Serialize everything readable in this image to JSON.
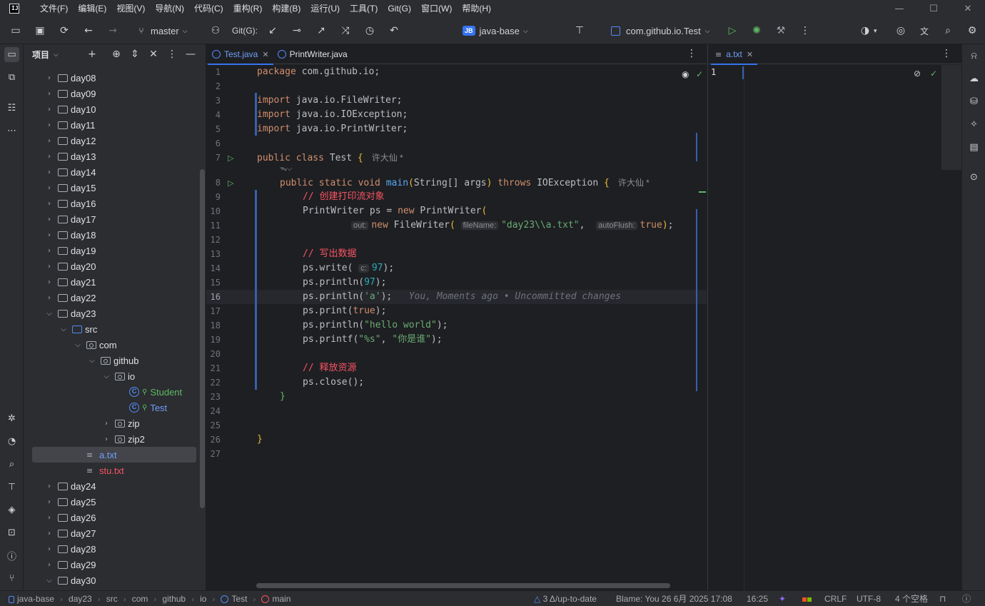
{
  "titlebar": {
    "menu": [
      "文件(F)",
      "编辑(E)",
      "视图(V)",
      "导航(N)",
      "代码(C)",
      "重构(R)",
      "构建(B)",
      "运行(U)",
      "工具(T)",
      "Git(G)",
      "窗口(W)",
      "帮助(H)"
    ],
    "minimize_glyph": "—",
    "maximize_glyph": "☐",
    "close_glyph": "✕"
  },
  "toolbar": {
    "branch": "master",
    "git_label": "Git(G):",
    "project_badge": "JB",
    "project_name": "java-base",
    "run_config": "com.github.io.Test"
  },
  "project_panel": {
    "title": "项目",
    "tree": [
      {
        "label": "day08",
        "type": "folder",
        "depth": 1,
        "expanded": false
      },
      {
        "label": "day09",
        "type": "folder",
        "depth": 1,
        "expanded": false
      },
      {
        "label": "day10",
        "type": "folder",
        "depth": 1,
        "expanded": false
      },
      {
        "label": "day11",
        "type": "folder",
        "depth": 1,
        "expanded": false
      },
      {
        "label": "day12",
        "type": "folder",
        "depth": 1,
        "expanded": false
      },
      {
        "label": "day13",
        "type": "folder",
        "depth": 1,
        "expanded": false
      },
      {
        "label": "day14",
        "type": "folder",
        "depth": 1,
        "expanded": false
      },
      {
        "label": "day15",
        "type": "folder",
        "depth": 1,
        "expanded": false
      },
      {
        "label": "day16",
        "type": "folder",
        "depth": 1,
        "expanded": false
      },
      {
        "label": "day17",
        "type": "folder",
        "depth": 1,
        "expanded": false
      },
      {
        "label": "day18",
        "type": "folder",
        "depth": 1,
        "expanded": false
      },
      {
        "label": "day19",
        "type": "folder",
        "depth": 1,
        "expanded": false
      },
      {
        "label": "day20",
        "type": "folder",
        "depth": 1,
        "expanded": false
      },
      {
        "label": "day21",
        "type": "folder",
        "depth": 1,
        "expanded": false
      },
      {
        "label": "day22",
        "type": "folder",
        "depth": 1,
        "expanded": false
      },
      {
        "label": "day23",
        "type": "folder",
        "depth": 1,
        "expanded": true
      },
      {
        "label": "src",
        "type": "src",
        "depth": 2,
        "expanded": true
      },
      {
        "label": "com",
        "type": "pkg",
        "depth": 3,
        "expanded": true
      },
      {
        "label": "github",
        "type": "pkg",
        "depth": 4,
        "expanded": true
      },
      {
        "label": "io",
        "type": "pkg",
        "depth": 5,
        "expanded": true
      },
      {
        "label": "Student",
        "type": "class",
        "depth": 6,
        "color": "green"
      },
      {
        "label": "Test",
        "type": "class",
        "depth": 6,
        "color": "blue"
      },
      {
        "label": "zip",
        "type": "pkg",
        "depth": 5,
        "expanded": false
      },
      {
        "label": "zip2",
        "type": "pkg",
        "depth": 5,
        "expanded": false
      },
      {
        "label": "a.txt",
        "type": "txt",
        "depth": 3,
        "color": "blue",
        "selected": true
      },
      {
        "label": "stu.txt",
        "type": "txt",
        "depth": 3,
        "color": "red"
      },
      {
        "label": "day24",
        "type": "folder",
        "depth": 1,
        "expanded": false
      },
      {
        "label": "day25",
        "type": "folder",
        "depth": 1,
        "expanded": false
      },
      {
        "label": "day26",
        "type": "folder",
        "depth": 1,
        "expanded": false
      },
      {
        "label": "day27",
        "type": "folder",
        "depth": 1,
        "expanded": false
      },
      {
        "label": "day28",
        "type": "folder",
        "depth": 1,
        "expanded": false
      },
      {
        "label": "day29",
        "type": "folder",
        "depth": 1,
        "expanded": false
      },
      {
        "label": "day30",
        "type": "folder",
        "depth": 1,
        "expanded": true
      }
    ]
  },
  "editor": {
    "tabs": [
      {
        "label": "Test.java",
        "active": true
      },
      {
        "label": "PrintWriter.java",
        "active": false
      }
    ],
    "current_line": 16,
    "author": "许大仙 *",
    "blame_inline": "You, Moments ago • Uncommitted changes",
    "line_numbers": [
      "1",
      "2",
      "3",
      "4",
      "5",
      "6",
      "7",
      "8",
      "9",
      "10",
      "11",
      "12",
      "13",
      "14",
      "15",
      "16",
      "17",
      "18",
      "19",
      "20",
      "21",
      "22",
      "23",
      "24",
      "25",
      "26",
      "27"
    ],
    "code": {
      "l1_pkg": "com.github.io;",
      "l3": "java.io.FileWriter;",
      "l4": "java.io.IOException;",
      "l5": "java.io.PrintWriter;",
      "l7_class": "Test",
      "l8_exc": "IOException",
      "l9_comment": "// 创建打印流对象",
      "l10": "PrintWriter ps = ",
      "l10_new": "new",
      "l10_tail": " PrintWriter",
      "hint_out": "out:",
      "hint_filename": "fileName:",
      "l11_str": "\"day23\\\\a.txt\"",
      "hint_autoflush": "autoFlush:",
      "l13_comment": "// 写出数据",
      "l14_call": "ps.write(",
      "hint_c": "c:",
      "l14_num": "97",
      "l15_call": "ps.println(",
      "l15_num": "97",
      "l16_call": "ps.println(",
      "l16_chr": "'a'",
      "l17_call": "ps.print(",
      "l18_call": "ps.println(",
      "l18_str": "\"hello world\"",
      "l19_call": "ps.printf(",
      "l19_str1": "\"%s\"",
      "l19_str2": "\"你是谁\"",
      "l21_comment": "// 释放资源",
      "l22": "ps.close();"
    }
  },
  "editor2": {
    "tab": "a.txt",
    "line": "1"
  },
  "statusbar": {
    "crumbs": [
      "java-base",
      "day23",
      "src",
      "com",
      "github",
      "io",
      "Test",
      "main"
    ],
    "vcs": "3 Δ/up-to-date",
    "blame": "Blame: You 26 6月 2025 17:08",
    "position": "16:25",
    "line_sep": "CRLF",
    "encoding": "UTF-8",
    "indent": "4 个空格"
  }
}
